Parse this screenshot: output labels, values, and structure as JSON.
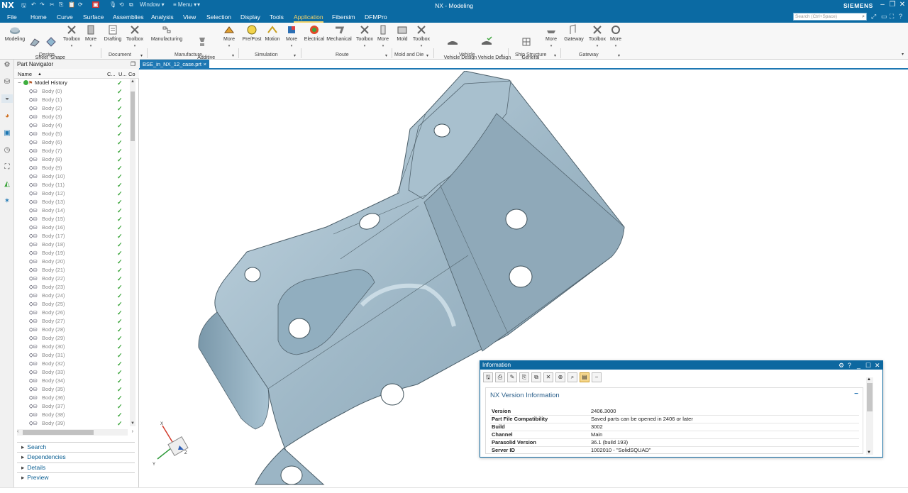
{
  "titlebar": {
    "app": "NX",
    "window_menu": "Window ▾",
    "menu_menu": "≡ Menu ▾",
    "title": "NX - Modeling",
    "brand": "SIEMENS"
  },
  "menubar": {
    "items": [
      "File",
      "Home",
      "Curve",
      "Surface",
      "Assemblies",
      "Analysis",
      "View",
      "Selection",
      "Display",
      "Tools",
      "Application",
      "Fibersim",
      "DFMPro"
    ],
    "active": "Application",
    "search_placeholder": "Search (Ctrl+Space)"
  },
  "ribbon": {
    "buttons": [
      {
        "label": "Modeling",
        "icon": "modeling-icon"
      },
      {
        "label": "Sheet\nMetal",
        "icon": "sheet-metal-icon"
      },
      {
        "label": "Shape\nStudio",
        "icon": "shape-studio-icon"
      },
      {
        "label": "Toolbox",
        "icon": "toolbox-icon"
      },
      {
        "label": "More",
        "icon": "more-icon"
      },
      {
        "label": "Drafting",
        "icon": "drafting-icon"
      },
      {
        "label": "Toolbox",
        "icon": "toolbox-icon"
      },
      {
        "label": "Manufacturing",
        "icon": "manufacturing-icon"
      },
      {
        "label": "Additive\nManufacturing",
        "icon": "additive-manufacturing-icon"
      },
      {
        "label": "More",
        "icon": "more-icon"
      },
      {
        "label": "Pre/Post",
        "icon": "pre-post-icon"
      },
      {
        "label": "Motion",
        "icon": "motion-icon"
      },
      {
        "label": "More",
        "icon": "more-icon"
      },
      {
        "label": "Electrical",
        "icon": "electrical-icon"
      },
      {
        "label": "Mechanical",
        "icon": "mechanical-icon"
      },
      {
        "label": "Toolbox",
        "icon": "toolbox-icon"
      },
      {
        "label": "More",
        "icon": "more-icon"
      },
      {
        "label": "Mold",
        "icon": "mold-icon"
      },
      {
        "label": "Toolbox",
        "icon": "toolbox-icon"
      },
      {
        "label": "Vehicle Design\nAutomation",
        "icon": "vehicle-design-automation-icon"
      },
      {
        "label": "Vehicle Design\nand Validation",
        "icon": "vehicle-design-validation-icon"
      },
      {
        "label": "General\nArrangement",
        "icon": "general-arrangement-icon"
      },
      {
        "label": "More",
        "icon": "more-icon"
      },
      {
        "label": "Gateway",
        "icon": "gateway-icon"
      },
      {
        "label": "Toolbox",
        "icon": "toolbox-icon"
      },
      {
        "label": "More",
        "icon": "more-icon"
      }
    ],
    "groups": [
      "Design",
      "Document",
      "Manufacture",
      "Simulation",
      "Route",
      "Mold and Die",
      "Vehicle",
      "Ship Structure",
      "Gateway"
    ]
  },
  "part_navigator": {
    "title": "Part Navigator",
    "columns": [
      "Name",
      "C...",
      "U...",
      "Co"
    ],
    "root": "Model History",
    "bodies": [
      "Body (0)",
      "Body (1)",
      "Body (2)",
      "Body (3)",
      "Body (4)",
      "Body (5)",
      "Body (6)",
      "Body (7)",
      "Body (8)",
      "Body (9)",
      "Body (10)",
      "Body (11)",
      "Body (12)",
      "Body (13)",
      "Body (14)",
      "Body (15)",
      "Body (16)",
      "Body (17)",
      "Body (18)",
      "Body (19)",
      "Body (20)",
      "Body (21)",
      "Body (22)",
      "Body (23)",
      "Body (24)",
      "Body (25)",
      "Body (26)",
      "Body (27)",
      "Body (28)",
      "Body (29)",
      "Body (30)",
      "Body (31)",
      "Body (32)",
      "Body (33)",
      "Body (34)",
      "Body (35)",
      "Body (36)",
      "Body (37)",
      "Body (38)",
      "Body (39)"
    ],
    "sections": [
      "Search",
      "Dependencies",
      "Details",
      "Preview"
    ]
  },
  "graphics": {
    "tab_label": "BSE_in_NX_12_case.prt",
    "part_color": "#9db8c8",
    "axis_labels": [
      "X",
      "Y",
      "Z"
    ]
  },
  "info_window": {
    "title": "Information",
    "heading": "NX Version Information",
    "rows": [
      {
        "key": "Version",
        "value": "2406.3000"
      },
      {
        "key": "Part File Compatibility",
        "value": "Saved parts can be opened in 2406 or later"
      },
      {
        "key": "Build",
        "value": "3002"
      },
      {
        "key": "Channel",
        "value": "Main"
      },
      {
        "key": "Parasolid Version",
        "value": "36.1 (build 193)"
      },
      {
        "key": "Server ID",
        "value": "1002010 - \"SolidSQUAD\""
      }
    ]
  }
}
